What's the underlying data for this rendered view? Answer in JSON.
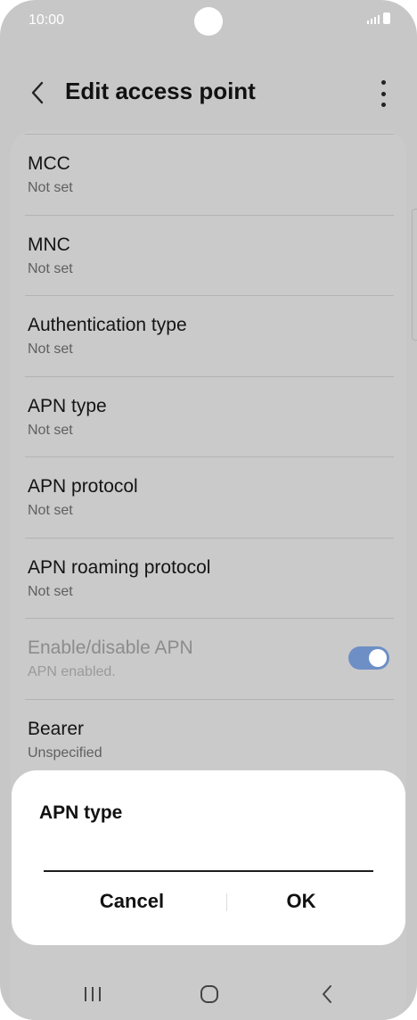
{
  "status_bar": {
    "time": "10:00"
  },
  "app_bar": {
    "title": "Edit access point"
  },
  "settings": [
    {
      "title": "MCC",
      "subtitle": "Not set"
    },
    {
      "title": "MNC",
      "subtitle": "Not set"
    },
    {
      "title": "Authentication type",
      "subtitle": "Not set"
    },
    {
      "title": "APN type",
      "subtitle": "Not set"
    },
    {
      "title": "APN protocol",
      "subtitle": "Not set"
    },
    {
      "title": "APN roaming protocol",
      "subtitle": "Not set"
    },
    {
      "title": "Enable/disable APN",
      "subtitle": "APN enabled.",
      "toggle_on": true,
      "disabled": true
    },
    {
      "title": "Bearer",
      "subtitle": "Unspecified"
    }
  ],
  "dialog": {
    "title": "APN type",
    "input_value": "",
    "cancel_label": "Cancel",
    "ok_label": "OK"
  },
  "colors": {
    "toggle_on": "#6d8fc6",
    "scrim": "#c7c7c7"
  }
}
